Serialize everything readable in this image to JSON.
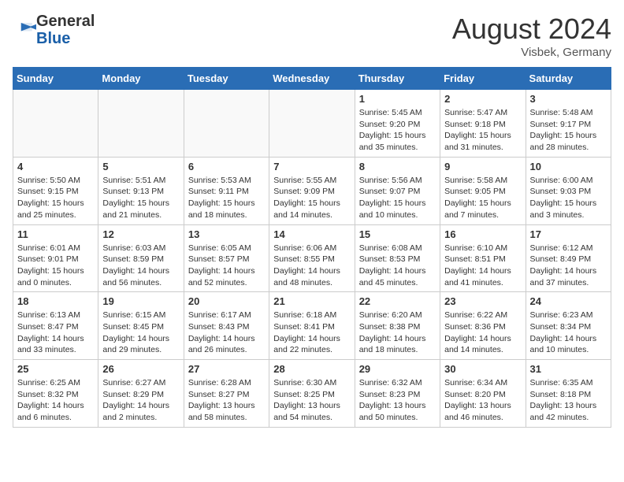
{
  "header": {
    "logo_general": "General",
    "logo_blue": "Blue",
    "month_title": "August 2024",
    "location": "Visbek, Germany"
  },
  "weekdays": [
    "Sunday",
    "Monday",
    "Tuesday",
    "Wednesday",
    "Thursday",
    "Friday",
    "Saturday"
  ],
  "weeks": [
    [
      {
        "day": "",
        "sunrise": "",
        "sunset": "",
        "daylight": ""
      },
      {
        "day": "",
        "sunrise": "",
        "sunset": "",
        "daylight": ""
      },
      {
        "day": "",
        "sunrise": "",
        "sunset": "",
        "daylight": ""
      },
      {
        "day": "",
        "sunrise": "",
        "sunset": "",
        "daylight": ""
      },
      {
        "day": "1",
        "sunrise": "Sunrise: 5:45 AM",
        "sunset": "Sunset: 9:20 PM",
        "daylight": "Daylight: 15 hours and 35 minutes."
      },
      {
        "day": "2",
        "sunrise": "Sunrise: 5:47 AM",
        "sunset": "Sunset: 9:18 PM",
        "daylight": "Daylight: 15 hours and 31 minutes."
      },
      {
        "day": "3",
        "sunrise": "Sunrise: 5:48 AM",
        "sunset": "Sunset: 9:17 PM",
        "daylight": "Daylight: 15 hours and 28 minutes."
      }
    ],
    [
      {
        "day": "4",
        "sunrise": "Sunrise: 5:50 AM",
        "sunset": "Sunset: 9:15 PM",
        "daylight": "Daylight: 15 hours and 25 minutes."
      },
      {
        "day": "5",
        "sunrise": "Sunrise: 5:51 AM",
        "sunset": "Sunset: 9:13 PM",
        "daylight": "Daylight: 15 hours and 21 minutes."
      },
      {
        "day": "6",
        "sunrise": "Sunrise: 5:53 AM",
        "sunset": "Sunset: 9:11 PM",
        "daylight": "Daylight: 15 hours and 18 minutes."
      },
      {
        "day": "7",
        "sunrise": "Sunrise: 5:55 AM",
        "sunset": "Sunset: 9:09 PM",
        "daylight": "Daylight: 15 hours and 14 minutes."
      },
      {
        "day": "8",
        "sunrise": "Sunrise: 5:56 AM",
        "sunset": "Sunset: 9:07 PM",
        "daylight": "Daylight: 15 hours and 10 minutes."
      },
      {
        "day": "9",
        "sunrise": "Sunrise: 5:58 AM",
        "sunset": "Sunset: 9:05 PM",
        "daylight": "Daylight: 15 hours and 7 minutes."
      },
      {
        "day": "10",
        "sunrise": "Sunrise: 6:00 AM",
        "sunset": "Sunset: 9:03 PM",
        "daylight": "Daylight: 15 hours and 3 minutes."
      }
    ],
    [
      {
        "day": "11",
        "sunrise": "Sunrise: 6:01 AM",
        "sunset": "Sunset: 9:01 PM",
        "daylight": "Daylight: 15 hours and 0 minutes."
      },
      {
        "day": "12",
        "sunrise": "Sunrise: 6:03 AM",
        "sunset": "Sunset: 8:59 PM",
        "daylight": "Daylight: 14 hours and 56 minutes."
      },
      {
        "day": "13",
        "sunrise": "Sunrise: 6:05 AM",
        "sunset": "Sunset: 8:57 PM",
        "daylight": "Daylight: 14 hours and 52 minutes."
      },
      {
        "day": "14",
        "sunrise": "Sunrise: 6:06 AM",
        "sunset": "Sunset: 8:55 PM",
        "daylight": "Daylight: 14 hours and 48 minutes."
      },
      {
        "day": "15",
        "sunrise": "Sunrise: 6:08 AM",
        "sunset": "Sunset: 8:53 PM",
        "daylight": "Daylight: 14 hours and 45 minutes."
      },
      {
        "day": "16",
        "sunrise": "Sunrise: 6:10 AM",
        "sunset": "Sunset: 8:51 PM",
        "daylight": "Daylight: 14 hours and 41 minutes."
      },
      {
        "day": "17",
        "sunrise": "Sunrise: 6:12 AM",
        "sunset": "Sunset: 8:49 PM",
        "daylight": "Daylight: 14 hours and 37 minutes."
      }
    ],
    [
      {
        "day": "18",
        "sunrise": "Sunrise: 6:13 AM",
        "sunset": "Sunset: 8:47 PM",
        "daylight": "Daylight: 14 hours and 33 minutes."
      },
      {
        "day": "19",
        "sunrise": "Sunrise: 6:15 AM",
        "sunset": "Sunset: 8:45 PM",
        "daylight": "Daylight: 14 hours and 29 minutes."
      },
      {
        "day": "20",
        "sunrise": "Sunrise: 6:17 AM",
        "sunset": "Sunset: 8:43 PM",
        "daylight": "Daylight: 14 hours and 26 minutes."
      },
      {
        "day": "21",
        "sunrise": "Sunrise: 6:18 AM",
        "sunset": "Sunset: 8:41 PM",
        "daylight": "Daylight: 14 hours and 22 minutes."
      },
      {
        "day": "22",
        "sunrise": "Sunrise: 6:20 AM",
        "sunset": "Sunset: 8:38 PM",
        "daylight": "Daylight: 14 hours and 18 minutes."
      },
      {
        "day": "23",
        "sunrise": "Sunrise: 6:22 AM",
        "sunset": "Sunset: 8:36 PM",
        "daylight": "Daylight: 14 hours and 14 minutes."
      },
      {
        "day": "24",
        "sunrise": "Sunrise: 6:23 AM",
        "sunset": "Sunset: 8:34 PM",
        "daylight": "Daylight: 14 hours and 10 minutes."
      }
    ],
    [
      {
        "day": "25",
        "sunrise": "Sunrise: 6:25 AM",
        "sunset": "Sunset: 8:32 PM",
        "daylight": "Daylight: 14 hours and 6 minutes."
      },
      {
        "day": "26",
        "sunrise": "Sunrise: 6:27 AM",
        "sunset": "Sunset: 8:29 PM",
        "daylight": "Daylight: 14 hours and 2 minutes."
      },
      {
        "day": "27",
        "sunrise": "Sunrise: 6:28 AM",
        "sunset": "Sunset: 8:27 PM",
        "daylight": "Daylight: 13 hours and 58 minutes."
      },
      {
        "day": "28",
        "sunrise": "Sunrise: 6:30 AM",
        "sunset": "Sunset: 8:25 PM",
        "daylight": "Daylight: 13 hours and 54 minutes."
      },
      {
        "day": "29",
        "sunrise": "Sunrise: 6:32 AM",
        "sunset": "Sunset: 8:23 PM",
        "daylight": "Daylight: 13 hours and 50 minutes."
      },
      {
        "day": "30",
        "sunrise": "Sunrise: 6:34 AM",
        "sunset": "Sunset: 8:20 PM",
        "daylight": "Daylight: 13 hours and 46 minutes."
      },
      {
        "day": "31",
        "sunrise": "Sunrise: 6:35 AM",
        "sunset": "Sunset: 8:18 PM",
        "daylight": "Daylight: 13 hours and 42 minutes."
      }
    ]
  ]
}
